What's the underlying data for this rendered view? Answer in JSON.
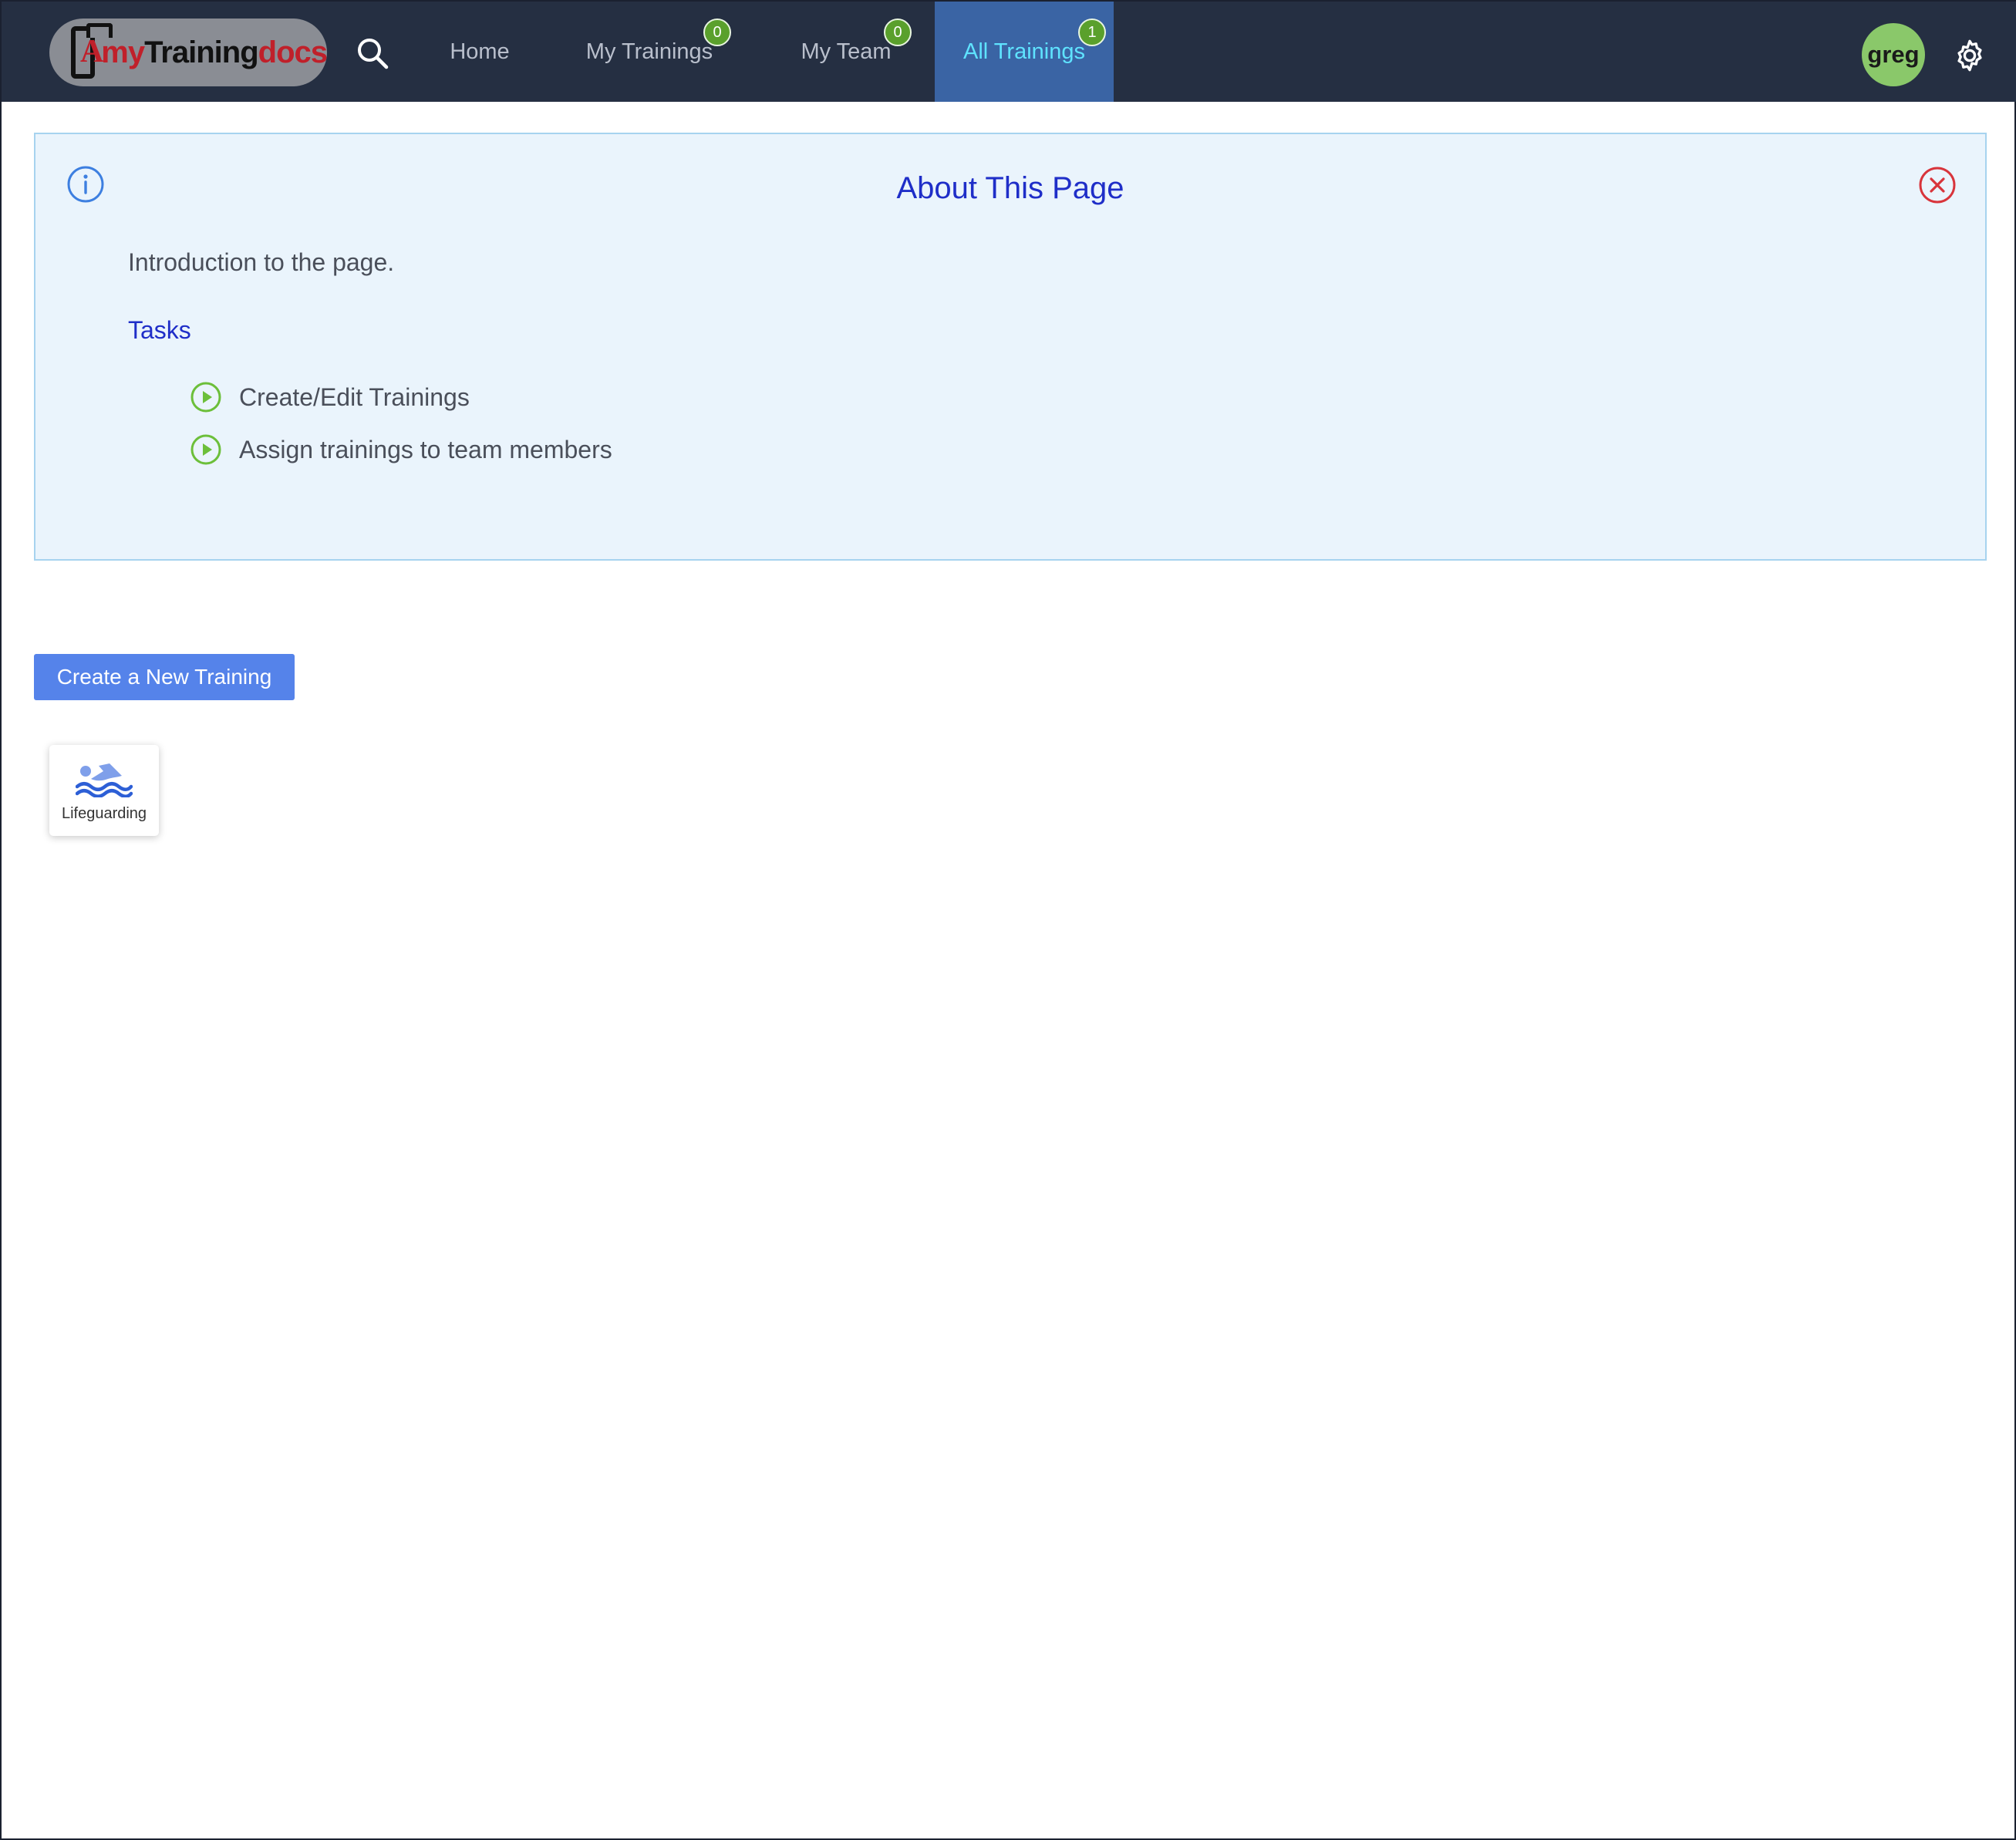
{
  "navbar": {
    "logo": {
      "text_parts": [
        "my",
        "Training",
        "docs"
      ],
      "letter": "A"
    },
    "items": [
      {
        "label": "Home"
      },
      {
        "label": "My Trainings",
        "badge": "0"
      },
      {
        "label": "My Team",
        "badge": "0"
      },
      {
        "label": "All Trainings",
        "badge": "1",
        "active": true
      }
    ],
    "user": {
      "avatar_text": "greg"
    },
    "icons": {
      "search": "search-icon",
      "settings": "gear-icon"
    }
  },
  "about": {
    "title": "About This Page",
    "intro": "Introduction to the page.",
    "tasks_heading": "Tasks",
    "tasks": [
      {
        "label": "Create/Edit Trainings",
        "icon": "play-circle-icon"
      },
      {
        "label": "Assign trainings to team members",
        "icon": "play-circle-icon"
      }
    ],
    "icons": {
      "info": "info-icon",
      "close": "close-icon"
    }
  },
  "actions": {
    "create_label": "Create a New Training"
  },
  "trainings": [
    {
      "label": "Lifeguarding",
      "icon": "swimmer-icon"
    }
  ],
  "colors": {
    "navbar_bg": "#252f42",
    "active_tab_bg": "#3a64a4",
    "active_tab_text": "#5fe3ff",
    "badge_green": "#5aa02c",
    "avatar_green": "#8ac86a",
    "panel_bg": "#eaf4fc",
    "panel_border": "#a7d3ef",
    "title_blue": "#1f2ec8",
    "button_blue": "#5583ea",
    "close_red": "#d8343b",
    "play_green": "#6cbf3a"
  }
}
